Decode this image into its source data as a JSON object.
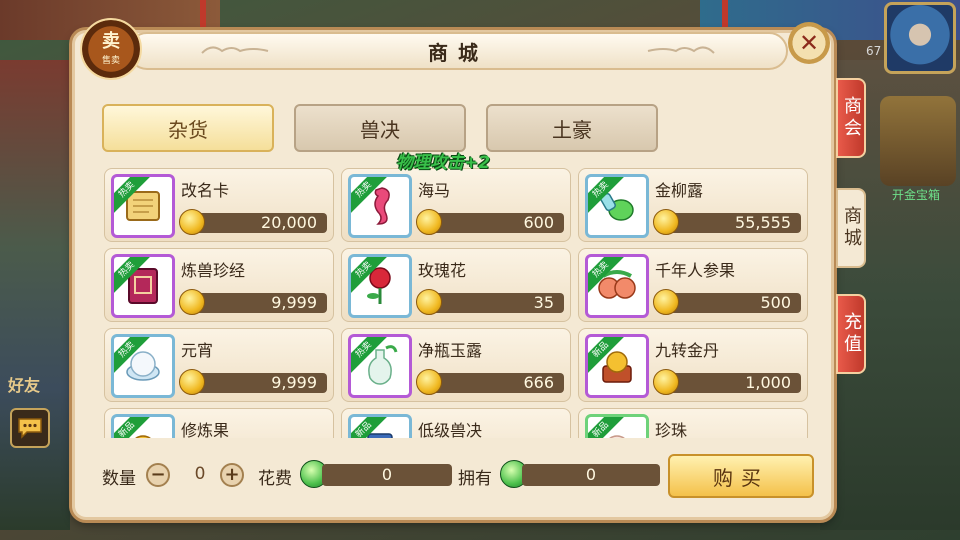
{
  "hud": {
    "level": "67",
    "chest_caption": "开金宝箱",
    "friends_label": "好友"
  },
  "shop": {
    "title": "商城",
    "emblem_glyph": "卖",
    "emblem_label": "售卖",
    "tabs": [
      {
        "label": "杂货",
        "active": true
      },
      {
        "label": "兽决",
        "active": false
      },
      {
        "label": "土豪",
        "active": false
      }
    ],
    "buff_text": "物理攻击+2",
    "items": [
      {
        "name": "改名卡",
        "price": "20,000",
        "badge": "热卖",
        "frame": "purple",
        "icon": "scroll-icon"
      },
      {
        "name": "海马",
        "price": "600",
        "badge": "热卖",
        "frame": "blue",
        "icon": "seahorse-icon"
      },
      {
        "name": "金柳露",
        "price": "55,555",
        "badge": "热卖",
        "frame": "blue",
        "icon": "elixir-icon"
      },
      {
        "name": "炼兽珍经",
        "price": "9,999",
        "badge": "热卖",
        "frame": "purple",
        "icon": "book-icon"
      },
      {
        "name": "玫瑰花",
        "price": "35",
        "badge": "热卖",
        "frame": "blue",
        "icon": "rose-icon"
      },
      {
        "name": "千年人参果",
        "price": "500",
        "badge": "热卖",
        "frame": "purple",
        "icon": "ginseng-fruit-icon"
      },
      {
        "name": "元宵",
        "price": "9,999",
        "badge": "热卖",
        "frame": "blue",
        "icon": "dumpling-icon"
      },
      {
        "name": "净瓶玉露",
        "price": "666",
        "badge": "热卖",
        "frame": "purple",
        "icon": "vase-icon"
      },
      {
        "name": "九转金丹",
        "price": "1,000",
        "badge": "新品",
        "frame": "purple",
        "icon": "golden-pill-icon"
      },
      {
        "name": "修炼果",
        "price": "",
        "badge": "新品",
        "frame": "blue",
        "icon": "fruit-icon"
      },
      {
        "name": "低级兽决",
        "price": "",
        "badge": "新品",
        "frame": "blue",
        "icon": "beast-book-icon"
      },
      {
        "name": "珍珠",
        "price": "",
        "badge": "新品",
        "frame": "green",
        "icon": "pearl-icon"
      }
    ],
    "bottom": {
      "quantity_label": "数量",
      "quantity_value": "0",
      "cost_label": "花费",
      "cost_value": "0",
      "owned_label": "拥有",
      "owned_value": "0",
      "buy_label": "购买"
    },
    "side_tabs": [
      {
        "label": "商会",
        "style": "red"
      },
      {
        "label": "商城",
        "style": "cream"
      },
      {
        "label": "充值",
        "style": "red"
      }
    ]
  },
  "colors": {
    "panel_bg": "#f4e9d4",
    "price_bar": "#6b5238",
    "buff_green": "#39c04a",
    "hot_badge": "#1f9e3a"
  }
}
